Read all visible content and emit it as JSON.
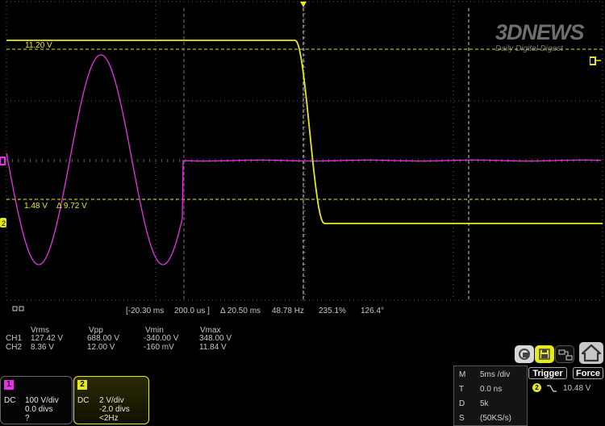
{
  "logo": {
    "brand": "3DNEWS",
    "tagline": "Daily Digital Digest"
  },
  "cursor_labels": {
    "level_top": "11.20 V",
    "level_bottom": "1.48 V",
    "delta_v": "Δ 9.72 V"
  },
  "readout": {
    "t1": "[-20.30 ms",
    "t2": "200.0 us ]",
    "dt": "Δ 20.50 ms",
    "freq": "48.78 Hz",
    "pct": "235.1%",
    "phase": "126.4°"
  },
  "measurements": {
    "headers": [
      "Vrms",
      "Vpp",
      "Vmin",
      "Vmax"
    ],
    "rows": [
      {
        "ch": "CH1",
        "values": [
          "127.42 V",
          "688.00 V",
          "-340.00 V",
          "348.00 V"
        ]
      },
      {
        "ch": "CH2",
        "values": [
          "8.36 V",
          "12.00 V",
          "-160 mV",
          "11.84 V"
        ]
      }
    ]
  },
  "channels": [
    {
      "num": "1",
      "coupling": "DC",
      "scale": "100 V/div",
      "offset": "0.0 divs",
      "freq": "?",
      "color": "#e830e8"
    },
    {
      "num": "2",
      "coupling": "DC",
      "scale": "2 V/div",
      "offset": "-2.0 divs",
      "freq": "<2Hz",
      "color": "#e8e81e"
    }
  ],
  "timebase": [
    {
      "k": "M",
      "v": "5ms /div"
    },
    {
      "k": "T",
      "v": "0.0 ns"
    },
    {
      "k": "D",
      "v": "5k"
    },
    {
      "k": "S",
      "v": "(50KS/s)"
    }
  ],
  "trigger": {
    "label": "Trigger",
    "force": "Force",
    "source": "2",
    "level": "10.48 V"
  },
  "colors": {
    "ch1": "#e830e8",
    "ch2": "#e8e81e",
    "grid": "#5a5a5a"
  },
  "icons": [
    "print-icon",
    "save-icon",
    "settings-icon",
    "home-icon"
  ]
}
